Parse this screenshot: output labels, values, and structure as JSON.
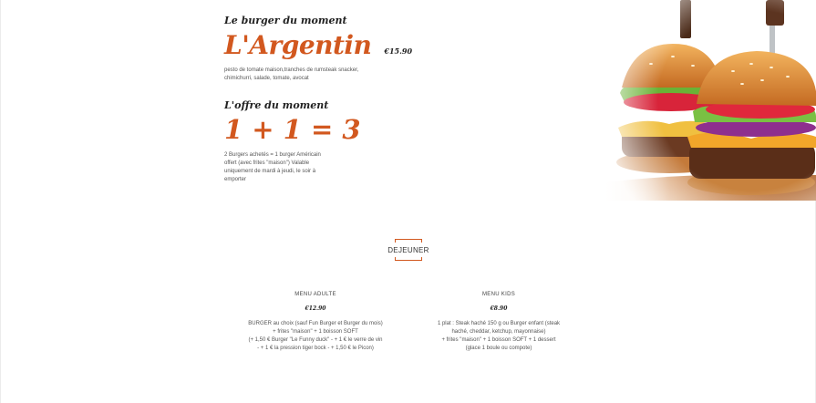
{
  "promo": {
    "kicker": "Le burger du moment",
    "burger_name": "L'Argentin",
    "burger_price": "€15.90",
    "burger_description": "pesto de tomate maison,tranches de rumsteak snacker, chimichurri, salade, tomate, avocat",
    "offer_kicker": "L'offre du moment",
    "offer_equation": "1 + 1 = 3",
    "offer_description": "2 Burgers achetés = 1 burger Américain offert (avec frites \"maison\") Valable uniquement de mardi à jeudi, le soir à emporter"
  },
  "section": {
    "title": "DEJEUNER"
  },
  "menus": [
    {
      "name": "MENU ADULTE",
      "price": "€12.90",
      "lines": [
        "BURGER au choix (sauf Fun Burger et Burger du mois)",
        "+ frites \"maison\" + 1 boisson SOFT",
        "(+ 1,50 € Burger \"Le Funny duck\" - + 1 € le verre de vin",
        "- + 1 € la pression tiger bock - + 1,50 € le Picon)"
      ]
    },
    {
      "name": "MENU KIDS",
      "price": "€8.90",
      "lines": [
        "1 plat : Steak haché 150 g ou Burger enfant (steak",
        "haché, cheddar, ketchup, mayonnaise)",
        "+ frites \"maison\" + 1 boisson SOFT + 1 dessert",
        "(glace 1 boule ou compote)"
      ]
    }
  ],
  "colors": {
    "accent": "#d2581f",
    "text": "#3a3a3a"
  },
  "icons": [
    "burger-photo"
  ]
}
